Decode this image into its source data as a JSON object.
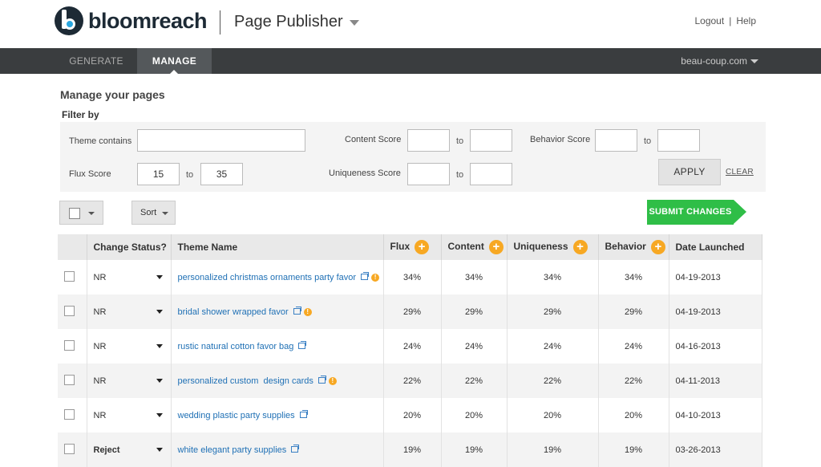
{
  "brand": {
    "name": "bloomreach",
    "app_title": "Page Publisher"
  },
  "top_links": {
    "logout": "Logout",
    "separator": "|",
    "help": "Help"
  },
  "nav": {
    "tabs": [
      {
        "label": "GENERATE"
      },
      {
        "label": "MANAGE"
      }
    ],
    "site": "beau-coup.com"
  },
  "page": {
    "heading": "Manage your pages"
  },
  "filter": {
    "title": "Filter by",
    "theme_label": "Theme contains",
    "theme_value": "",
    "content_label": "Content Score",
    "content_from": "",
    "content_to": "",
    "behavior_label": "Behavior Score",
    "behavior_from": "",
    "behavior_to": "",
    "flux_label": "Flux Score",
    "flux_from": "15",
    "flux_to": "35",
    "uniq_label": "Uniqueness Score",
    "uniq_from": "",
    "uniq_to": "",
    "to_label": "to",
    "apply": "APPLY",
    "clear": "CLEAR"
  },
  "toolbar": {
    "sort": "Sort",
    "submit": "SUBMIT CHANGES"
  },
  "colors": {
    "accent_green": "#2fbe47",
    "accent_orange": "#f7a823",
    "link_blue": "#1f70b5",
    "nav_bg": "#3a3d3f"
  },
  "table": {
    "headers": {
      "status": "Change Status?",
      "theme": "Theme Name",
      "flux": "Flux",
      "content": "Content",
      "uniqueness": "Uniqueness",
      "behavior": "Behavior",
      "date": "Date Launched"
    },
    "plus": "+",
    "warn": "!",
    "rows": [
      {
        "status": "NR",
        "theme": "personalized christmas ornaments party favor",
        "warning": true,
        "flux": "34%",
        "content": "34%",
        "uniqueness": "34%",
        "behavior": "34%",
        "date": "04-19-2013"
      },
      {
        "status": "NR",
        "theme": "bridal shower wrapped favor",
        "warning": true,
        "flux": "29%",
        "content": "29%",
        "uniqueness": "29%",
        "behavior": "29%",
        "date": "04-19-2013"
      },
      {
        "status": "NR",
        "theme": "rustic natural cotton favor bag",
        "warning": false,
        "flux": "24%",
        "content": "24%",
        "uniqueness": "24%",
        "behavior": "24%",
        "date": "04-16-2013"
      },
      {
        "status": "NR",
        "theme": "personalized custom  design cards",
        "warning": true,
        "flux": "22%",
        "content": "22%",
        "uniqueness": "22%",
        "behavior": "22%",
        "date": "04-11-2013"
      },
      {
        "status": "NR",
        "theme": "wedding plastic party supplies",
        "warning": false,
        "flux": "20%",
        "content": "20%",
        "uniqueness": "20%",
        "behavior": "20%",
        "date": "04-10-2013"
      },
      {
        "status": "Reject",
        "theme": "white elegant party supplies",
        "warning": false,
        "flux": "19%",
        "content": "19%",
        "uniqueness": "19%",
        "behavior": "19%",
        "date": "03-26-2013"
      }
    ]
  }
}
